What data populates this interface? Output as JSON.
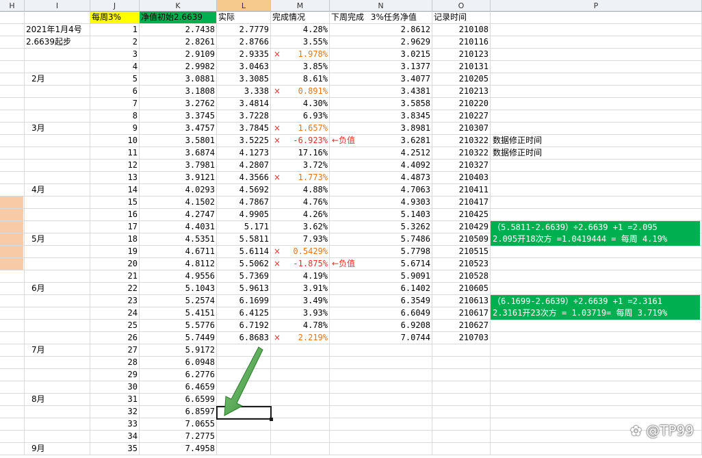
{
  "columns": [
    "H",
    "I",
    "J",
    "K",
    "L",
    "M",
    "N",
    "O",
    "P"
  ],
  "headers": {
    "j": "每周3%",
    "k": "净值初始2.6639",
    "l": "实际",
    "m": "完成情况",
    "n_label": "下周完成",
    "n_label2": "3%任务净值",
    "o": "记录时间"
  },
  "notes": {
    "i1": "2021年1月4号",
    "i2": "2.6639起步",
    "feb": "2月",
    "mar": "3月",
    "apr": "4月",
    "may": "5月",
    "jun": "6月",
    "jul": "7月",
    "aug": "8月",
    "sep": "9月",
    "neg1": "←负值",
    "neg2": "←负值",
    "fix1": "数据修正时间",
    "fix2": "数据修正时间",
    "calc1a": "（5.5811-2.6639）÷2.6639 +1 =2.095",
    "calc1b": "2.095开18次方 =1.0419444 = 每周 4.19%",
    "calc2a": "（6.1699-2.6639）÷2.6639 +1 =2.3161",
    "calc2b": "2.3161开23次方 = 1.03719= 每周 3.719%",
    "cross": "×"
  },
  "rows": [
    {
      "j": "1",
      "k": "2.7438",
      "l": "2.7779",
      "m": "4.28%",
      "x": false,
      "n": "2.8612",
      "o": "210108"
    },
    {
      "j": "2",
      "k": "2.8261",
      "l": "2.8766",
      "m": "3.55%",
      "x": false,
      "n": "2.9629",
      "o": "210116"
    },
    {
      "j": "3",
      "k": "2.9109",
      "l": "2.9335",
      "m": "1.978%",
      "x": true,
      "n": "3.0215",
      "o": "210123"
    },
    {
      "j": "4",
      "k": "2.9982",
      "l": "3.0463",
      "m": "3.85%",
      "x": false,
      "n": "3.1377",
      "o": "210131"
    },
    {
      "j": "5",
      "k": "3.0881",
      "l": "3.3085",
      "m": "8.61%",
      "x": false,
      "n": "3.4077",
      "o": "210205"
    },
    {
      "j": "6",
      "k": "3.1808",
      "l": "3.338",
      "m": "0.891%",
      "x": true,
      "n": "3.4381",
      "o": "210213"
    },
    {
      "j": "7",
      "k": "3.2762",
      "l": "3.4814",
      "m": "4.30%",
      "x": false,
      "n": "3.5858",
      "o": "210220"
    },
    {
      "j": "8",
      "k": "3.3745",
      "l": "3.7228",
      "m": "6.93%",
      "x": false,
      "n": "3.8345",
      "o": "210227"
    },
    {
      "j": "9",
      "k": "3.4757",
      "l": "3.7845",
      "m": "1.657%",
      "x": true,
      "n": "3.8981",
      "o": "210307"
    },
    {
      "j": "10",
      "k": "3.5801",
      "l": "3.5225",
      "m": "-6.923%",
      "x": true,
      "neg": true,
      "n": "3.6281",
      "o": "210322"
    },
    {
      "j": "11",
      "k": "3.6874",
      "l": "4.1273",
      "m": "17.16%",
      "x": false,
      "n": "4.2512",
      "o": "210322"
    },
    {
      "j": "12",
      "k": "3.7981",
      "l": "4.2807",
      "m": "3.72%",
      "x": false,
      "n": "4.4092",
      "o": "210327"
    },
    {
      "j": "13",
      "k": "3.9121",
      "l": "4.3566",
      "m": "1.773%",
      "x": true,
      "n": "4.4873",
      "o": "210403"
    },
    {
      "j": "14",
      "k": "4.0293",
      "l": "4.5692",
      "m": "4.88%",
      "x": false,
      "n": "4.7063",
      "o": "210411"
    },
    {
      "j": "15",
      "k": "4.1502",
      "l": "4.7867",
      "m": "4.76%",
      "x": false,
      "n": "4.9303",
      "o": "210417"
    },
    {
      "j": "16",
      "k": "4.2747",
      "l": "4.9905",
      "m": "4.26%",
      "x": false,
      "n": "5.1403",
      "o": "210425"
    },
    {
      "j": "17",
      "k": "4.4031",
      "l": "5.171",
      "m": "3.62%",
      "x": false,
      "n": "5.3262",
      "o": "210429"
    },
    {
      "j": "18",
      "k": "4.5351",
      "l": "5.5811",
      "m": "7.93%",
      "x": false,
      "n": "5.7486",
      "o": "210509"
    },
    {
      "j": "19",
      "k": "4.6711",
      "l": "5.6114",
      "m": "0.5429%",
      "x": true,
      "n": "5.7798",
      "o": "210515"
    },
    {
      "j": "20",
      "k": "4.8112",
      "l": "5.5062",
      "m": "-1.875%",
      "x": true,
      "neg": true,
      "n": "5.6714",
      "o": "210523"
    },
    {
      "j": "21",
      "k": "4.9556",
      "l": "5.7369",
      "m": "4.19%",
      "x": false,
      "n": "5.9091",
      "o": "210528"
    },
    {
      "j": "22",
      "k": "5.1043",
      "l": "5.9613",
      "m": "3.91%",
      "x": false,
      "n": "6.1402",
      "o": "210605"
    },
    {
      "j": "23",
      "k": "5.2574",
      "l": "6.1699",
      "m": "3.49%",
      "x": false,
      "n": "6.3549",
      "o": "210613"
    },
    {
      "j": "24",
      "k": "5.4151",
      "l": "6.4125",
      "m": "3.93%",
      "x": false,
      "n": "6.6049",
      "o": "210617"
    },
    {
      "j": "25",
      "k": "5.5776",
      "l": "6.7192",
      "m": "4.78%",
      "x": false,
      "n": "6.9208",
      "o": "210627"
    },
    {
      "j": "26",
      "k": "5.7449",
      "l": "6.8683",
      "m": "2.219%",
      "x": true,
      "n": "7.0744",
      "o": "210703"
    },
    {
      "j": "27",
      "k": "5.9172",
      "l": "",
      "m": "",
      "x": false,
      "n": "",
      "o": ""
    },
    {
      "j": "28",
      "k": "6.0948",
      "l": "",
      "m": "",
      "x": false,
      "n": "",
      "o": ""
    },
    {
      "j": "29",
      "k": "6.2776",
      "l": "",
      "m": "",
      "x": false,
      "n": "",
      "o": ""
    },
    {
      "j": "30",
      "k": "6.4659",
      "l": "",
      "m": "",
      "x": false,
      "n": "",
      "o": ""
    },
    {
      "j": "31",
      "k": "6.6599",
      "l": "",
      "m": "",
      "x": false,
      "n": "",
      "o": ""
    },
    {
      "j": "32",
      "k": "6.8597",
      "l": "",
      "m": "",
      "x": false,
      "n": "",
      "o": ""
    },
    {
      "j": "33",
      "k": "7.0655",
      "l": "",
      "m": "",
      "x": false,
      "n": "",
      "o": ""
    },
    {
      "j": "34",
      "k": "7.2775",
      "l": "",
      "m": "",
      "x": false,
      "n": "",
      "o": ""
    },
    {
      "j": "35",
      "k": "7.4958",
      "l": "",
      "m": "",
      "x": false,
      "n": "",
      "o": ""
    }
  ],
  "watermark": "@TP99"
}
